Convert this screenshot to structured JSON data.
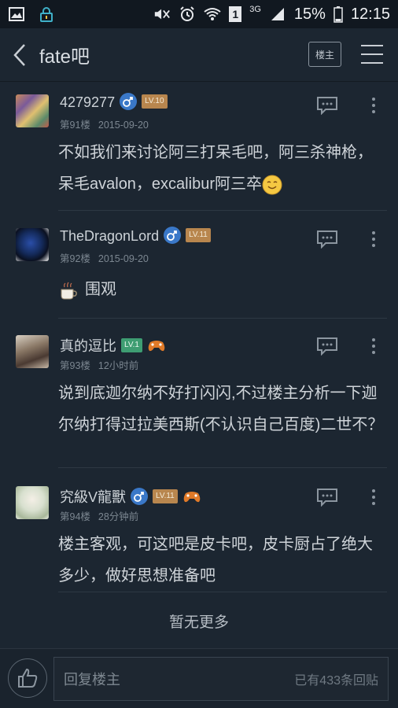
{
  "status_bar": {
    "battery": "15%",
    "time": "12:15",
    "network": "3G",
    "sim": "1"
  },
  "header": {
    "back_icon": "chevron-left-icon",
    "title": "fate吧",
    "owner_button": "楼主",
    "menu_icon": "hamburger-icon"
  },
  "posts": [
    {
      "username": "4279277",
      "gender": "male",
      "level": "LV.10",
      "floor": "第91楼",
      "time": "2015-09-20",
      "content": "不如我们来讨论阿三打呆毛吧，阿三杀神枪，呆毛avalon，excalibur阿三卒"
    },
    {
      "username": "TheDragonLord",
      "gender": "male",
      "level": "LV.11",
      "floor": "第92楼",
      "time": "2015-09-20",
      "content": "围观"
    },
    {
      "username": "真的逗比",
      "level": "LV.1",
      "floor": "第93楼",
      "time": "12小时前",
      "content": "说到底迦尔纳不好打闪闪,不过楼主分析一下迦尔纳打得过拉美西斯(不认识自己百度)二世不？"
    },
    {
      "username": "究級V龍獸",
      "gender": "male",
      "level": "LV.11",
      "floor": "第94楼",
      "time": "28分钟前",
      "content": "楼主客观，可这吧是皮卡吧，皮卡厨占了绝大多少，做好思想准备吧"
    }
  ],
  "footer_text": "暂无更多",
  "bottom_bar": {
    "like_icon": "thumbs-up-icon",
    "reply_placeholder": "回复楼主",
    "reply_count": "已有433条回贴"
  },
  "colors": {
    "background": "#1c2631",
    "status_bar": "#111820",
    "level_orange": "#b8864e",
    "level_green": "#3e9d72",
    "male_blue": "#3a78c8"
  }
}
